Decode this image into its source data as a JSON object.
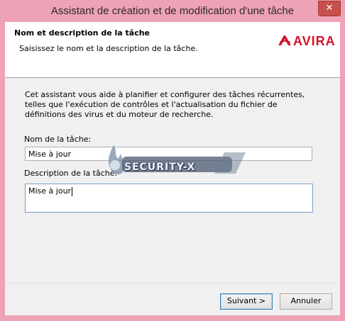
{
  "window": {
    "title": "Assistant de création et de modification d'une tâche",
    "close_glyph": "✕"
  },
  "header": {
    "title": "Nom et description de la tâche",
    "subtitle": "Saisissez le nom et la description de la tâche.",
    "logo_text": "AVIRA",
    "logo_color": "#d3122a"
  },
  "body": {
    "intro": "Cet assistant vous aide à planifier et configurer des tâches récurrentes, telles que l'exécution de contrôles et l'actualisation du fichier de définitions des virus et du moteur de recherche.",
    "name_label": "Nom de la tâche:",
    "name_value": "Mise à jour",
    "description_label": "Description de la tâche:",
    "description_value": "Mise à jour"
  },
  "buttons": {
    "next_label": "Suivant >",
    "cancel_label": "Annuler"
  },
  "watermark": {
    "text": "SECURITY-X"
  },
  "colors": {
    "titlebar": "#eea2b5",
    "close_button": "#c7504a",
    "default_button_border": "#3c7fb1"
  }
}
